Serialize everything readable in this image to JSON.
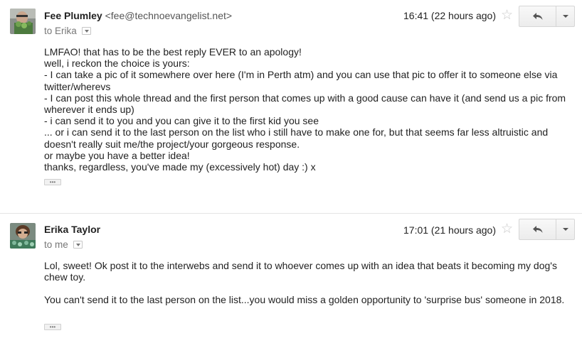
{
  "messages": [
    {
      "sender_name": "Fee Plumley",
      "sender_email": "<fee@technoevangelist.net>",
      "recipient": "to Erika",
      "time": "16:41 (22 hours ago)",
      "body_lines": [
        "LMFAO! that has to be the best reply EVER to an apology!",
        "well, i reckon the choice is yours:",
        "- I can take a pic of it somewhere over here (I'm in Perth atm) and you can use that pic to offer it to someone else via twitter/wherevs",
        "- I can post this whole thread and the first person that comes up with a good cause can have it (and send us a pic from wherever it ends up)",
        "- i can send it to you and you can give it to the first kid you see",
        "... or i can send it to the last person on the list who i still have to make one for, but that seems far less altruistic and doesn't really suit me/the project/your gorgeous response.",
        "or maybe you have a better idea!",
        "thanks, regardless, you've made my (excessively hot) day :) x"
      ],
      "ellipsis": "•••"
    },
    {
      "sender_name": "Erika Taylor",
      "sender_email": "",
      "recipient": "to me",
      "time": "17:01 (21 hours ago)",
      "body_lines": [
        "Lol, sweet! Ok post it to the interwebs and send it to whoever comes up with an idea that beats it becoming my dog's chew toy.",
        "",
        "You can't send it to the last person on the list...you would miss a golden opportunity to 'surprise bus' someone in 2018."
      ],
      "ellipsis": "•••"
    }
  ],
  "icons": {
    "star": "☆",
    "reply": "reply-arrow-icon",
    "more": "chevron-down-icon"
  },
  "colors": {
    "star": "#c8c8c8",
    "secondary_text": "#777777",
    "divider": "#e5e5e5"
  }
}
